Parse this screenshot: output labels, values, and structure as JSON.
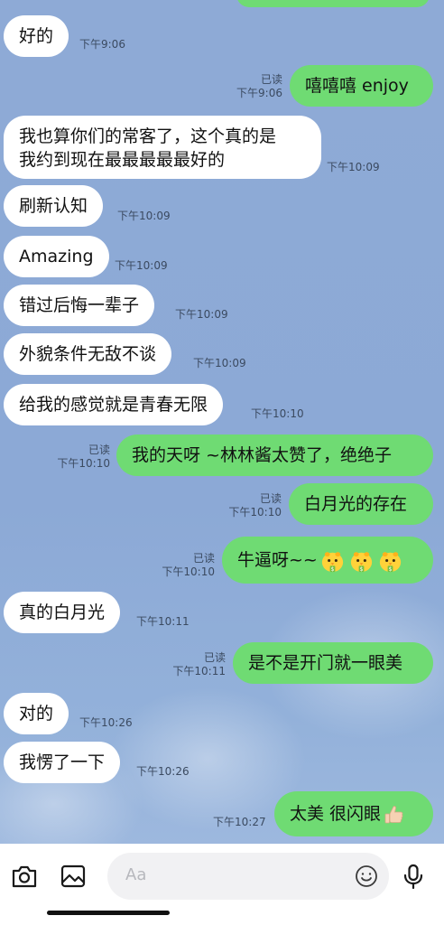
{
  "messages": [
    {
      "id": "m1",
      "dir": "in",
      "text": "好的",
      "time": "下午9:06"
    },
    {
      "id": "m2",
      "dir": "out",
      "text": "嘻嘻嘻  enjoy",
      "time": "下午9:06",
      "read": "已读"
    },
    {
      "id": "m3",
      "dir": "in",
      "line1": "我也算你们的常客了，这个真的是",
      "line2": "我约到现在最最最最最好的",
      "time": "下午10:09"
    },
    {
      "id": "m4",
      "dir": "in",
      "text": "刷新认知",
      "time": "下午10:09"
    },
    {
      "id": "m5",
      "dir": "in",
      "text": "Amazing",
      "time": "下午10:09"
    },
    {
      "id": "m6",
      "dir": "in",
      "text": "错过后悔一辈子",
      "time": "下午10:09"
    },
    {
      "id": "m7",
      "dir": "in",
      "text": "外貌条件无敌不谈",
      "time": "下午10:09"
    },
    {
      "id": "m8",
      "dir": "in",
      "text": "给我的感觉就是青春无限",
      "time": "下午10:10"
    },
    {
      "id": "m9",
      "dir": "out",
      "text": "我的天呀 ~林林酱太赞了，绝绝子",
      "time": "下午10:10",
      "read": "已读"
    },
    {
      "id": "m10",
      "dir": "out",
      "text": "白月光的存在",
      "time": "下午10:10",
      "read": "已读"
    },
    {
      "id": "m11",
      "dir": "out",
      "text": "牛逼呀~~",
      "emoji": "chick-money-emoji",
      "time": "下午10:10",
      "read": "已读"
    },
    {
      "id": "m12",
      "dir": "in",
      "text": "真的白月光",
      "time": "下午10:11"
    },
    {
      "id": "m13",
      "dir": "out",
      "text": "是不是开门就一眼美",
      "time": "下午10:11",
      "read": "已读"
    },
    {
      "id": "m14",
      "dir": "in",
      "text": "对的",
      "time": "下午10:26"
    },
    {
      "id": "m15",
      "dir": "in",
      "text": "我愣了一下",
      "time": "下午10:26"
    },
    {
      "id": "m16",
      "dir": "out",
      "text": "太美 很闪眼",
      "emoji": "thumbs-up-emoji",
      "time": "下午10:27"
    }
  ],
  "input": {
    "placeholder": "Aa"
  },
  "icons": {
    "camera": "camera-icon",
    "image": "image-icon",
    "emoji": "smiley-icon",
    "mic": "microphone-icon"
  },
  "colors": {
    "chat_background": "#8eaad6",
    "incoming_bubble": "#ffffff",
    "outgoing_bubble": "#6fdb73",
    "meta_text": "#3b4a60"
  }
}
